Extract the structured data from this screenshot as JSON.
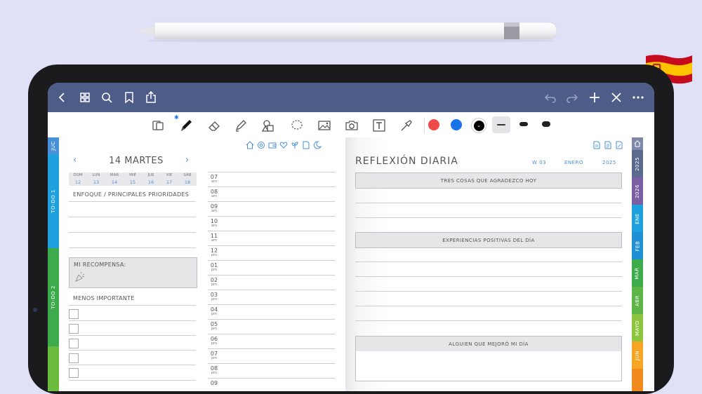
{
  "toolbar_colors": {
    "red": "#ee4b48",
    "blue": "#1a73e8",
    "black": "#000000",
    "topbar": "#4e5c88"
  },
  "icons": [
    "back-icon",
    "grid-icon",
    "search-icon",
    "bookmark-icon",
    "share-icon",
    "undo-icon",
    "redo-icon",
    "add-icon",
    "close-icon",
    "more-icon"
  ],
  "left_tabs": [
    "JUC",
    "TO-DO 1",
    "TO-DO 2"
  ],
  "right_tabs": [
    "2025",
    "2026",
    "ENE",
    "FEB",
    "MAR",
    "ABR",
    "MAYO",
    "JUN"
  ],
  "day": {
    "header": "14 MARTES",
    "week": [
      {
        "d": "DOM",
        "n": "12"
      },
      {
        "d": "LUN",
        "n": "13"
      },
      {
        "d": "MAR",
        "n": "14"
      },
      {
        "d": "MIÉ",
        "n": "15"
      },
      {
        "d": "JUE",
        "n": "16"
      },
      {
        "d": "VIE",
        "n": "17"
      },
      {
        "d": "SÁB",
        "n": "18"
      }
    ],
    "focus_label": "ENFOQUE / PRINCIPALES PRIORIDADES",
    "reward_label": "MI RECOMPENSA:",
    "least_label": "MENOS IMPORTANTE"
  },
  "hours": [
    {
      "h": "07",
      "ap": "am"
    },
    {
      "h": "08",
      "ap": "am"
    },
    {
      "h": "09",
      "ap": "am"
    },
    {
      "h": "10",
      "ap": "am"
    },
    {
      "h": "11",
      "ap": "am"
    },
    {
      "h": "12",
      "ap": "pm"
    },
    {
      "h": "01",
      "ap": "pm"
    },
    {
      "h": "02",
      "ap": "pm"
    },
    {
      "h": "03",
      "ap": "pm"
    },
    {
      "h": "04",
      "ap": "pm"
    },
    {
      "h": "05",
      "ap": "pm"
    },
    {
      "h": "06",
      "ap": "pm"
    },
    {
      "h": "07",
      "ap": "pm"
    },
    {
      "h": "08",
      "ap": "pm"
    },
    {
      "h": "09",
      "ap": ""
    }
  ],
  "reflection": {
    "title": "REFLEXIÓN DIARIA",
    "week": "W 03",
    "month": "ENERO",
    "year": "2025",
    "sections": [
      "TRES COSAS QUE AGRADEZCO HOY",
      "EXPERIENCIAS POSITIVAS DEL DÍA",
      "ALGUIEN QUE MEJORÓ MI DÍA"
    ]
  }
}
